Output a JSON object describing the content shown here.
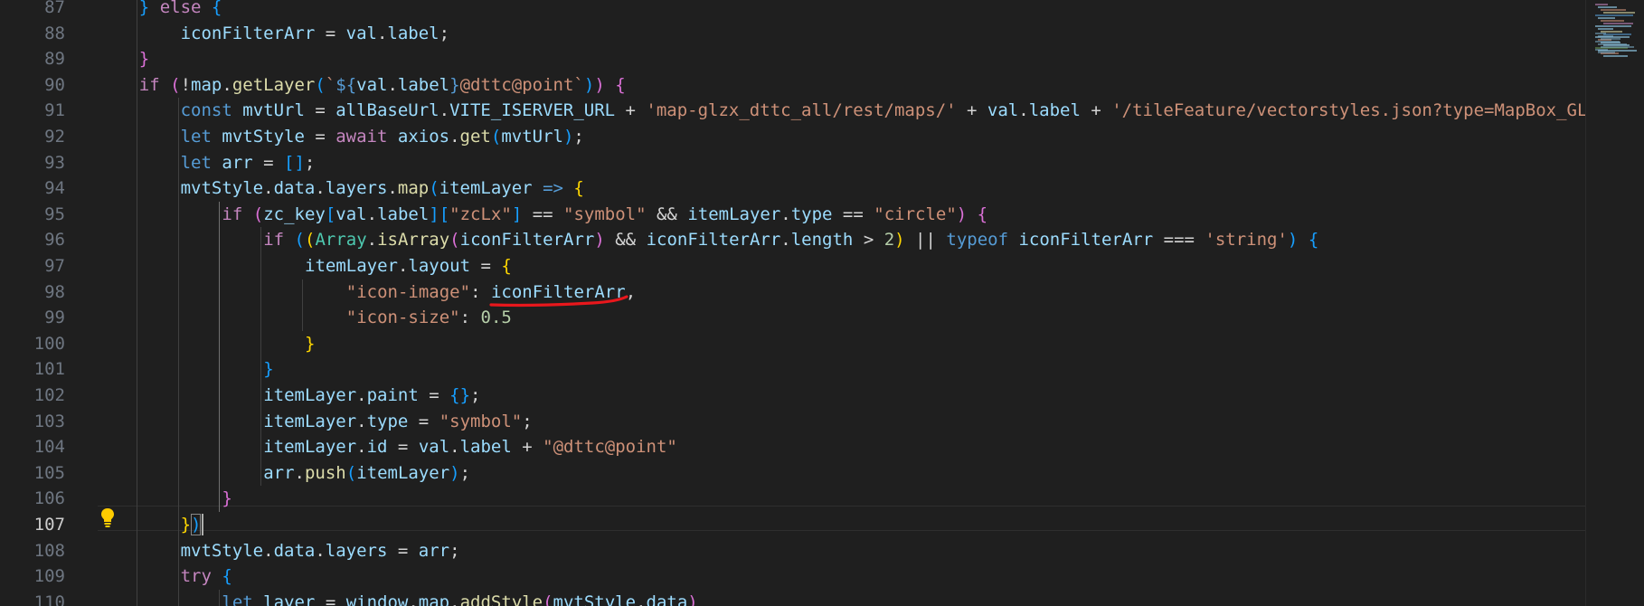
{
  "editor": {
    "active_line": 107,
    "colors": {
      "background": "#1f1f1f",
      "keyword": "#569cd6",
      "control": "#c586c0",
      "variable": "#9cdcfe",
      "function": "#dcdcaa",
      "string": "#ce9178",
      "number": "#b5cea8",
      "bracket_gold": "#ffd700",
      "bracket_orchid": "#da70d6",
      "bracket_blue": "#179fff",
      "annotation_red": "#e8171c"
    },
    "annotation": "red-underline-under-iconFilterArr-line-98",
    "lightbulb_icon": "lightbulb-icon",
    "lines": [
      {
        "n": 87,
        "indent": 1,
        "tokens": [
          [
            "p3",
            "} "
          ],
          [
            "ctl",
            "else"
          ],
          [
            "op",
            " "
          ],
          [
            "p3",
            "{"
          ]
        ]
      },
      {
        "n": 88,
        "indent": 2,
        "tokens": [
          [
            "var",
            "iconFilterArr"
          ],
          [
            "op",
            " = "
          ],
          [
            "var",
            "val"
          ],
          [
            "op",
            "."
          ],
          [
            "var",
            "label"
          ],
          [
            "op",
            ";"
          ]
        ]
      },
      {
        "n": 89,
        "indent": 1,
        "tokens": [
          [
            "p2",
            "}"
          ]
        ]
      },
      {
        "n": 90,
        "indent": 1,
        "tokens": [
          [
            "ctl",
            "if"
          ],
          [
            "op",
            " "
          ],
          [
            "p2",
            "("
          ],
          [
            "op",
            "!"
          ],
          [
            "var",
            "map"
          ],
          [
            "op",
            "."
          ],
          [
            "fn",
            "getLayer"
          ],
          [
            "p3",
            "("
          ],
          [
            "str",
            "`"
          ],
          [
            "tplx",
            "${"
          ],
          [
            "var",
            "val"
          ],
          [
            "op",
            "."
          ],
          [
            "var",
            "label"
          ],
          [
            "tplx",
            "}"
          ],
          [
            "str",
            "@dttc@point`"
          ],
          [
            "p3",
            ")"
          ],
          [
            "p2",
            ")"
          ],
          [
            "op",
            " "
          ],
          [
            "p2",
            "{"
          ]
        ]
      },
      {
        "n": 91,
        "indent": 2,
        "tokens": [
          [
            "kw",
            "const"
          ],
          [
            "op",
            " "
          ],
          [
            "var",
            "mvtUrl"
          ],
          [
            "op",
            " = "
          ],
          [
            "var",
            "allBaseUrl"
          ],
          [
            "op",
            "."
          ],
          [
            "var",
            "VITE_ISERVER_URL"
          ],
          [
            "op",
            " + "
          ],
          [
            "str",
            "'map-glzx_dttc_all/rest/maps/'"
          ],
          [
            "op",
            " + "
          ],
          [
            "var",
            "val"
          ],
          [
            "op",
            "."
          ],
          [
            "var",
            "label"
          ],
          [
            "op",
            " + "
          ],
          [
            "str",
            "'/tileFeature/vectorstyles.json?type=MapBox_GL"
          ]
        ]
      },
      {
        "n": 92,
        "indent": 2,
        "tokens": [
          [
            "kw",
            "let"
          ],
          [
            "op",
            " "
          ],
          [
            "var",
            "mvtStyle"
          ],
          [
            "op",
            " = "
          ],
          [
            "ctl",
            "await"
          ],
          [
            "op",
            " "
          ],
          [
            "var",
            "axios"
          ],
          [
            "op",
            "."
          ],
          [
            "fn",
            "get"
          ],
          [
            "p3",
            "("
          ],
          [
            "var",
            "mvtUrl"
          ],
          [
            "p3",
            ")"
          ],
          [
            "op",
            ";"
          ]
        ]
      },
      {
        "n": 93,
        "indent": 2,
        "tokens": [
          [
            "kw",
            "let"
          ],
          [
            "op",
            " "
          ],
          [
            "var",
            "arr"
          ],
          [
            "op",
            " = "
          ],
          [
            "p3",
            "[]"
          ],
          [
            "op",
            ";"
          ]
        ]
      },
      {
        "n": 94,
        "indent": 2,
        "tokens": [
          [
            "var",
            "mvtStyle"
          ],
          [
            "op",
            "."
          ],
          [
            "var",
            "data"
          ],
          [
            "op",
            "."
          ],
          [
            "var",
            "layers"
          ],
          [
            "op",
            "."
          ],
          [
            "fn",
            "map"
          ],
          [
            "p3",
            "("
          ],
          [
            "var",
            "itemLayer"
          ],
          [
            "op",
            " "
          ],
          [
            "kw",
            "=>"
          ],
          [
            "op",
            " "
          ],
          [
            "p1",
            "{"
          ]
        ]
      },
      {
        "n": 95,
        "indent": 3,
        "tokens": [
          [
            "ctl",
            "if"
          ],
          [
            "op",
            " "
          ],
          [
            "p2",
            "("
          ],
          [
            "var",
            "zc_key"
          ],
          [
            "p3",
            "["
          ],
          [
            "var",
            "val"
          ],
          [
            "op",
            "."
          ],
          [
            "var",
            "label"
          ],
          [
            "p3",
            "]"
          ],
          [
            "p3",
            "["
          ],
          [
            "str",
            "\"zcLx\""
          ],
          [
            "p3",
            "]"
          ],
          [
            "op",
            " == "
          ],
          [
            "str",
            "\"symbol\""
          ],
          [
            "op",
            " && "
          ],
          [
            "var",
            "itemLayer"
          ],
          [
            "op",
            "."
          ],
          [
            "var",
            "type"
          ],
          [
            "op",
            " == "
          ],
          [
            "str",
            "\"circle\""
          ],
          [
            "p2",
            ")"
          ],
          [
            "op",
            " "
          ],
          [
            "p2",
            "{"
          ]
        ]
      },
      {
        "n": 96,
        "indent": 4,
        "tokens": [
          [
            "ctl",
            "if"
          ],
          [
            "op",
            " "
          ],
          [
            "p3",
            "("
          ],
          [
            "p1",
            "("
          ],
          [
            "type",
            "Array"
          ],
          [
            "op",
            "."
          ],
          [
            "fn",
            "isArray"
          ],
          [
            "p2",
            "("
          ],
          [
            "var",
            "iconFilterArr"
          ],
          [
            "p2",
            ")"
          ],
          [
            "op",
            " && "
          ],
          [
            "var",
            "iconFilterArr"
          ],
          [
            "op",
            "."
          ],
          [
            "var",
            "length"
          ],
          [
            "op",
            " > "
          ],
          [
            "num",
            "2"
          ],
          [
            "p1",
            ")"
          ],
          [
            "op",
            " || "
          ],
          [
            "kw",
            "typeof"
          ],
          [
            "op",
            " "
          ],
          [
            "var",
            "iconFilterArr"
          ],
          [
            "op",
            " === "
          ],
          [
            "str",
            "'string'"
          ],
          [
            "p3",
            ")"
          ],
          [
            "op",
            " "
          ],
          [
            "p3",
            "{"
          ]
        ]
      },
      {
        "n": 97,
        "indent": 5,
        "tokens": [
          [
            "var",
            "itemLayer"
          ],
          [
            "op",
            "."
          ],
          [
            "var",
            "layout"
          ],
          [
            "op",
            " = "
          ],
          [
            "p1",
            "{"
          ]
        ]
      },
      {
        "n": 98,
        "indent": 6,
        "tokens": [
          [
            "str",
            "\"icon-image\""
          ],
          [
            "op",
            ": "
          ],
          [
            "var",
            "iconFilterArr"
          ],
          [
            "op",
            ","
          ]
        ]
      },
      {
        "n": 99,
        "indent": 6,
        "tokens": [
          [
            "str",
            "\"icon-size\""
          ],
          [
            "op",
            ": "
          ],
          [
            "num",
            "0.5"
          ]
        ]
      },
      {
        "n": 100,
        "indent": 5,
        "tokens": [
          [
            "p1",
            "}"
          ]
        ]
      },
      {
        "n": 101,
        "indent": 4,
        "tokens": [
          [
            "p3",
            "}"
          ]
        ]
      },
      {
        "n": 102,
        "indent": 4,
        "tokens": [
          [
            "var",
            "itemLayer"
          ],
          [
            "op",
            "."
          ],
          [
            "var",
            "paint"
          ],
          [
            "op",
            " = "
          ],
          [
            "p3",
            "{}"
          ],
          [
            "op",
            ";"
          ]
        ]
      },
      {
        "n": 103,
        "indent": 4,
        "tokens": [
          [
            "var",
            "itemLayer"
          ],
          [
            "op",
            "."
          ],
          [
            "var",
            "type"
          ],
          [
            "op",
            " = "
          ],
          [
            "str",
            "\"symbol\""
          ],
          [
            "op",
            ";"
          ]
        ]
      },
      {
        "n": 104,
        "indent": 4,
        "tokens": [
          [
            "var",
            "itemLayer"
          ],
          [
            "op",
            "."
          ],
          [
            "var",
            "id"
          ],
          [
            "op",
            " = "
          ],
          [
            "var",
            "val"
          ],
          [
            "op",
            "."
          ],
          [
            "var",
            "label"
          ],
          [
            "op",
            " + "
          ],
          [
            "str",
            "\"@dttc@point\""
          ]
        ]
      },
      {
        "n": 105,
        "indent": 4,
        "tokens": [
          [
            "var",
            "arr"
          ],
          [
            "op",
            "."
          ],
          [
            "fn",
            "push"
          ],
          [
            "p3",
            "("
          ],
          [
            "var",
            "itemLayer"
          ],
          [
            "p3",
            ")"
          ],
          [
            "op",
            ";"
          ]
        ]
      },
      {
        "n": 106,
        "indent": 3,
        "tokens": [
          [
            "p2",
            "}"
          ]
        ]
      },
      {
        "n": 107,
        "indent": 2,
        "tokens": [
          [
            "p1",
            "}"
          ],
          [
            "p3",
            ")"
          ]
        ]
      },
      {
        "n": 108,
        "indent": 2,
        "tokens": [
          [
            "var",
            "mvtStyle"
          ],
          [
            "op",
            "."
          ],
          [
            "var",
            "data"
          ],
          [
            "op",
            "."
          ],
          [
            "var",
            "layers"
          ],
          [
            "op",
            " = "
          ],
          [
            "var",
            "arr"
          ],
          [
            "op",
            ";"
          ]
        ]
      },
      {
        "n": 109,
        "indent": 2,
        "tokens": [
          [
            "ctl",
            "try"
          ],
          [
            "op",
            " "
          ],
          [
            "p3",
            "{"
          ]
        ]
      },
      {
        "n": 110,
        "indent": 3,
        "tokens": [
          [
            "kw",
            "let"
          ],
          [
            "op",
            " "
          ],
          [
            "var",
            "layer"
          ],
          [
            "op",
            " = "
          ],
          [
            "var",
            "window"
          ],
          [
            "op",
            "."
          ],
          [
            "var",
            "map"
          ],
          [
            "op",
            "."
          ],
          [
            "fn",
            "addStyle"
          ],
          [
            "p2",
            "("
          ],
          [
            "var",
            "mvtStyle"
          ],
          [
            "op",
            "."
          ],
          [
            "var",
            "data"
          ],
          [
            "p2",
            ")"
          ]
        ]
      }
    ]
  }
}
